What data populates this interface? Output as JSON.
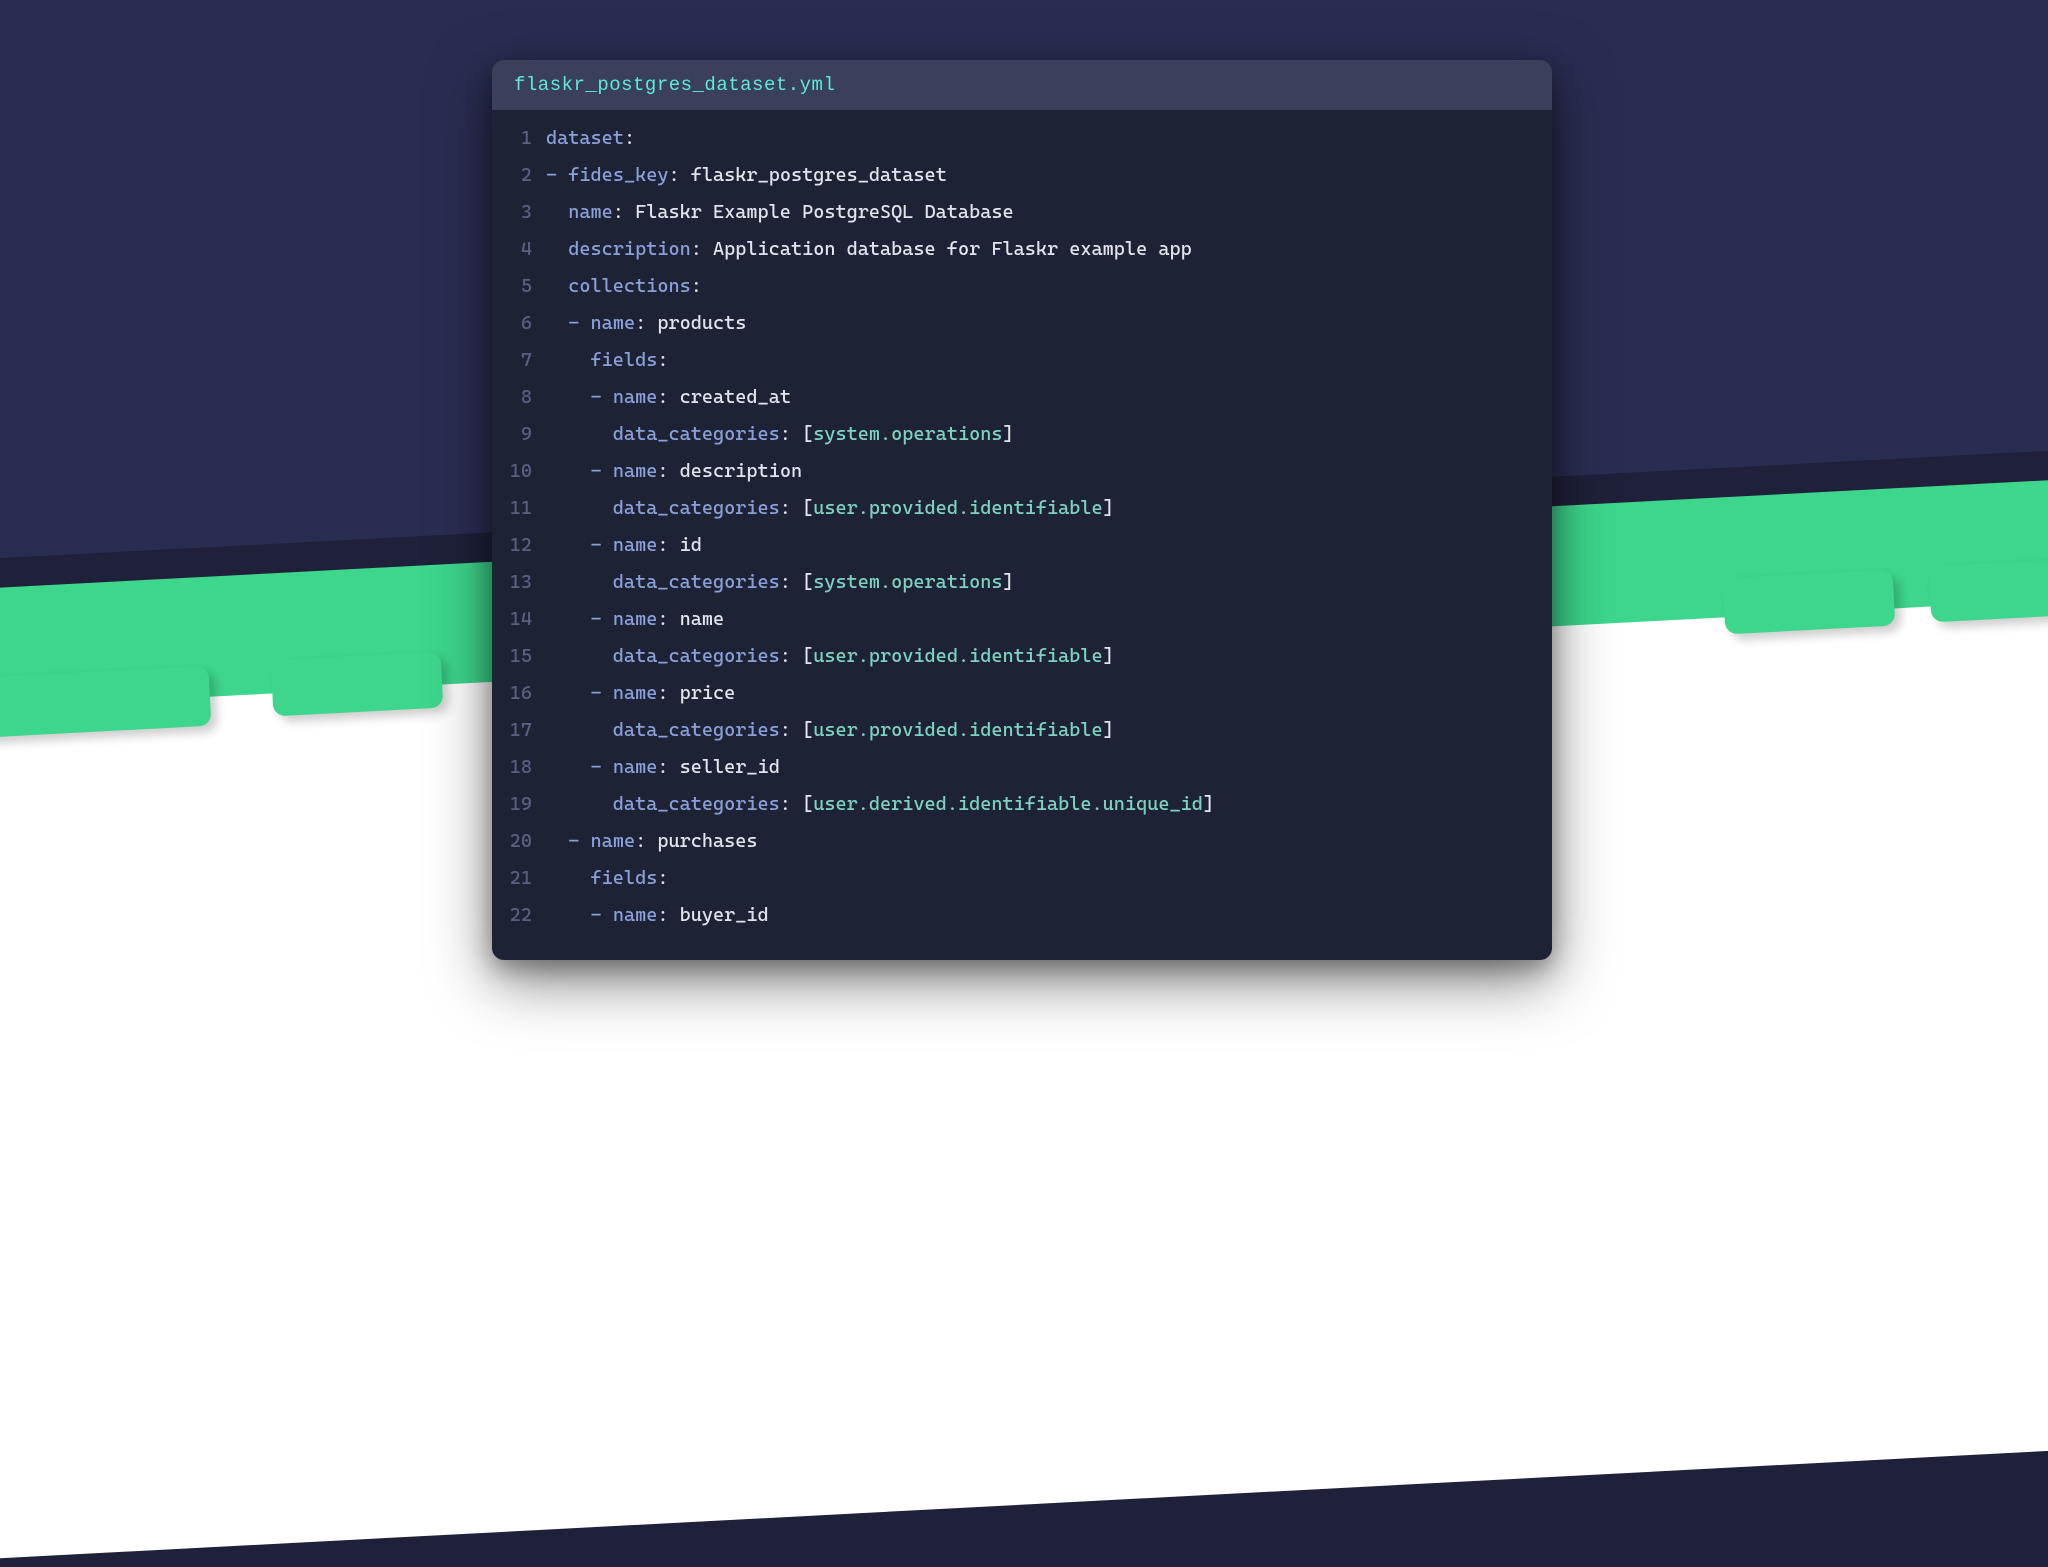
{
  "filename": "flaskr_postgres_dataset.yml",
  "lines": [
    {
      "n": "1",
      "indent": 0,
      "dash": false,
      "key": "dataset",
      "colon": true,
      "val": ""
    },
    {
      "n": "2",
      "indent": 0,
      "dash": true,
      "key": "fides_key",
      "colon": true,
      "val": "flaskr_postgres_dataset"
    },
    {
      "n": "3",
      "indent": 1,
      "dash": false,
      "key": "name",
      "colon": true,
      "val": "Flaskr Example PostgreSQL Database"
    },
    {
      "n": "4",
      "indent": 1,
      "dash": false,
      "key": "description",
      "colon": true,
      "val": "Application database for Flaskr example app"
    },
    {
      "n": "5",
      "indent": 1,
      "dash": false,
      "key": "collections",
      "colon": true,
      "val": ""
    },
    {
      "n": "6",
      "indent": 1,
      "dash": true,
      "key": "name",
      "colon": true,
      "val": "products"
    },
    {
      "n": "7",
      "indent": 2,
      "dash": false,
      "key": "fields",
      "colon": true,
      "val": ""
    },
    {
      "n": "8",
      "indent": 2,
      "dash": true,
      "key": "name",
      "colon": true,
      "val": "created_at"
    },
    {
      "n": "9",
      "indent": 3,
      "dash": false,
      "key": "data_categories",
      "colon": true,
      "bracketed": "system.operations"
    },
    {
      "n": "10",
      "indent": 2,
      "dash": true,
      "key": "name",
      "colon": true,
      "val": "description"
    },
    {
      "n": "11",
      "indent": 3,
      "dash": false,
      "key": "data_categories",
      "colon": true,
      "bracketed": "user.provided.identifiable"
    },
    {
      "n": "12",
      "indent": 2,
      "dash": true,
      "key": "name",
      "colon": true,
      "val": "id"
    },
    {
      "n": "13",
      "indent": 3,
      "dash": false,
      "key": "data_categories",
      "colon": true,
      "bracketed": "system.operations"
    },
    {
      "n": "14",
      "indent": 2,
      "dash": true,
      "key": "name",
      "colon": true,
      "val": "name"
    },
    {
      "n": "15",
      "indent": 3,
      "dash": false,
      "key": "data_categories",
      "colon": true,
      "bracketed": "user.provided.identifiable"
    },
    {
      "n": "16",
      "indent": 2,
      "dash": true,
      "key": "name",
      "colon": true,
      "val": "price"
    },
    {
      "n": "17",
      "indent": 3,
      "dash": false,
      "key": "data_categories",
      "colon": true,
      "bracketed": "user.provided.identifiable"
    },
    {
      "n": "18",
      "indent": 2,
      "dash": true,
      "key": "name",
      "colon": true,
      "val": "seller_id"
    },
    {
      "n": "19",
      "indent": 3,
      "dash": false,
      "key": "data_categories",
      "colon": true,
      "bracketed": "user.derived.identifiable.unique_id"
    },
    {
      "n": "20",
      "indent": 1,
      "dash": true,
      "key": "name",
      "colon": true,
      "val": "purchases"
    },
    {
      "n": "21",
      "indent": 2,
      "dash": false,
      "key": "fields",
      "colon": true,
      "val": ""
    },
    {
      "n": "22",
      "indent": 2,
      "dash": true,
      "key": "name",
      "colon": true,
      "val": "buyer_id"
    }
  ]
}
